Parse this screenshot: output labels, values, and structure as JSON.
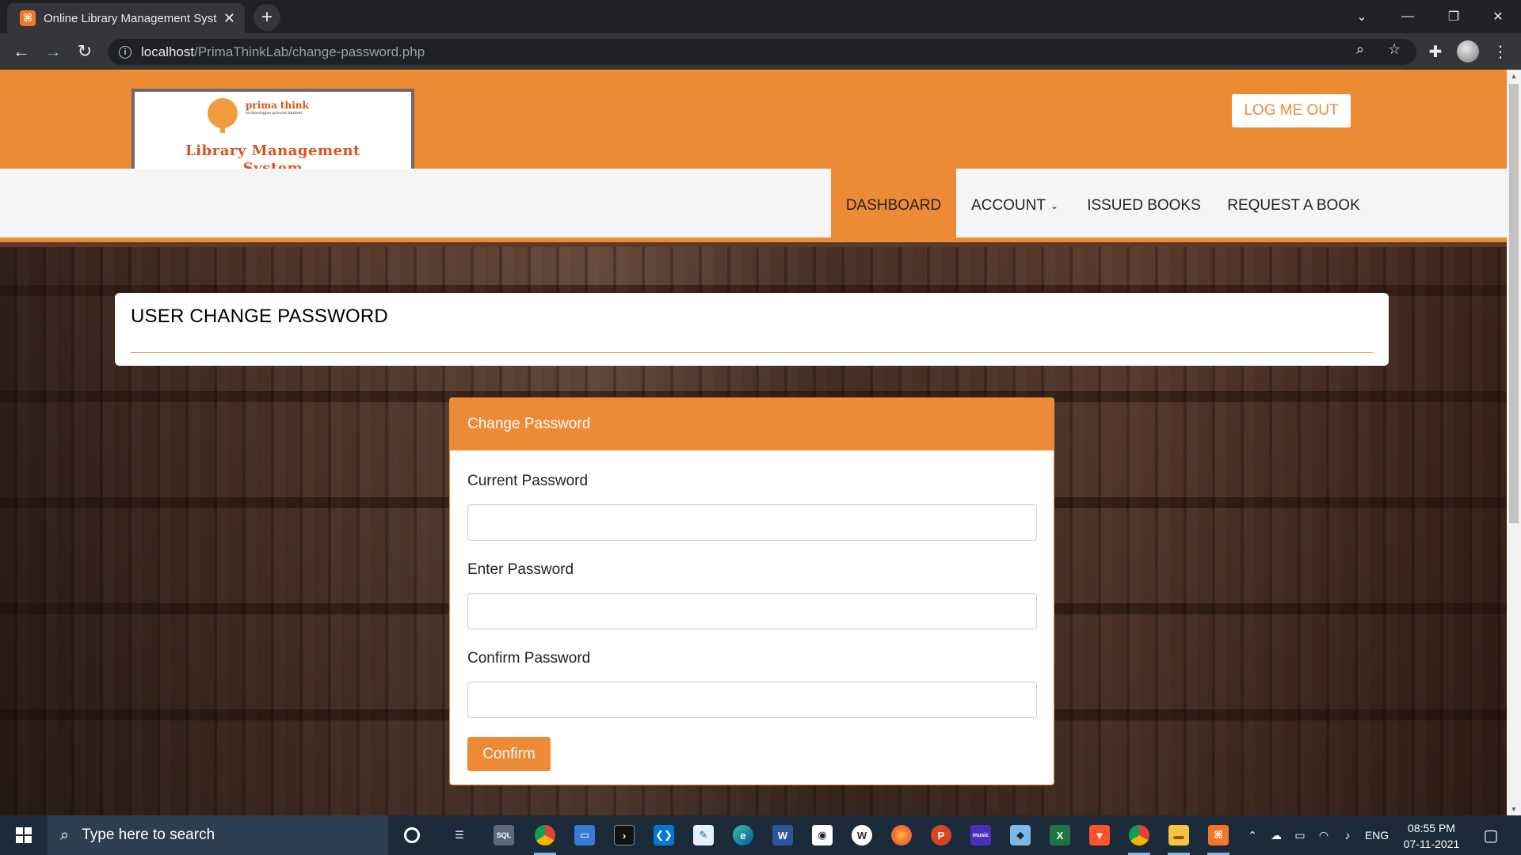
{
  "browser": {
    "tab_title": "Online Library Management Syst",
    "favicon": "xampp-icon",
    "url_host": "localhost",
    "url_path": "/PrimaThinkLab/change-password.php"
  },
  "header": {
    "logo": {
      "company": "prima think",
      "company_sub": "technologies private limited",
      "title_line1": "Library Management",
      "title_line2": "System"
    },
    "logout_label": "LOG ME OUT"
  },
  "nav": {
    "items": [
      {
        "label": "DASHBOARD",
        "active": true
      },
      {
        "label": "ACCOUNT",
        "has_dropdown": true
      },
      {
        "label": "ISSUED BOOKS"
      },
      {
        "label": "REQUEST A BOOK"
      }
    ]
  },
  "page": {
    "heading": "USER CHANGE PASSWORD"
  },
  "form": {
    "panel_title": "Change Password",
    "current_label": "Current Password",
    "current_value": "",
    "new_label": "Enter Password",
    "new_value": "",
    "confirm_label": "Confirm Password",
    "confirm_value": "",
    "submit_label": "Confirm"
  },
  "colors": {
    "accent": "#ec8a36",
    "menubar": "#f5f5f5",
    "taskbar": "#1c2b3a"
  },
  "taskbar": {
    "search_placeholder": "Type here to search",
    "language": "ENG",
    "time": "08:55 PM",
    "date": "07-11-2021"
  }
}
